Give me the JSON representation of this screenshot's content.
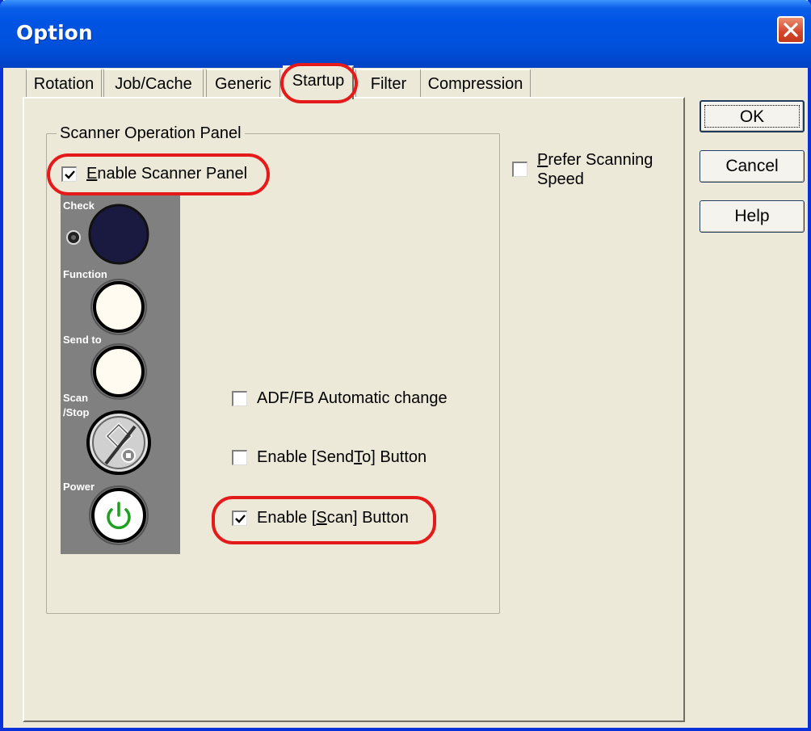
{
  "window": {
    "title": "Option"
  },
  "tabs": [
    {
      "label": "Rotation"
    },
    {
      "label": "Job/Cache"
    },
    {
      "label": "Generic"
    },
    {
      "label": "Startup",
      "active": true
    },
    {
      "label": "Filter"
    },
    {
      "label": "Compression"
    }
  ],
  "group": {
    "title": "Scanner Operation Panel"
  },
  "checkboxes": {
    "enable_scanner_panel": {
      "pre": "",
      "ul": "E",
      "post": "nable Scanner Panel",
      "checked": true
    },
    "prefer_scanning_speed": {
      "pre": "",
      "ul": "P",
      "line1": "refer Scanning",
      "line2": "Speed",
      "checked": false
    },
    "adf_fb": {
      "pre": "ADF/FB Automatic change",
      "checked": false
    },
    "send_to": {
      "pre": "Enable [Send",
      "ul": "T",
      "post": "o] Button",
      "checked": false
    },
    "scan": {
      "pre": "Enable [",
      "ul": "S",
      "post": "can] Button",
      "checked": true
    }
  },
  "scanner_panel": {
    "labels": {
      "check": "Check",
      "function": "Function",
      "send_to": "Send to",
      "scan": "Scan",
      "stop": "/Stop",
      "power": "Power"
    }
  },
  "buttons": {
    "ok": "OK",
    "cancel": "Cancel",
    "help": "Help"
  },
  "colors": {
    "titlebar": "#0054e3",
    "face": "#ece9d8",
    "highlight": "#e51b1b",
    "power_icon": "#1ea020"
  }
}
